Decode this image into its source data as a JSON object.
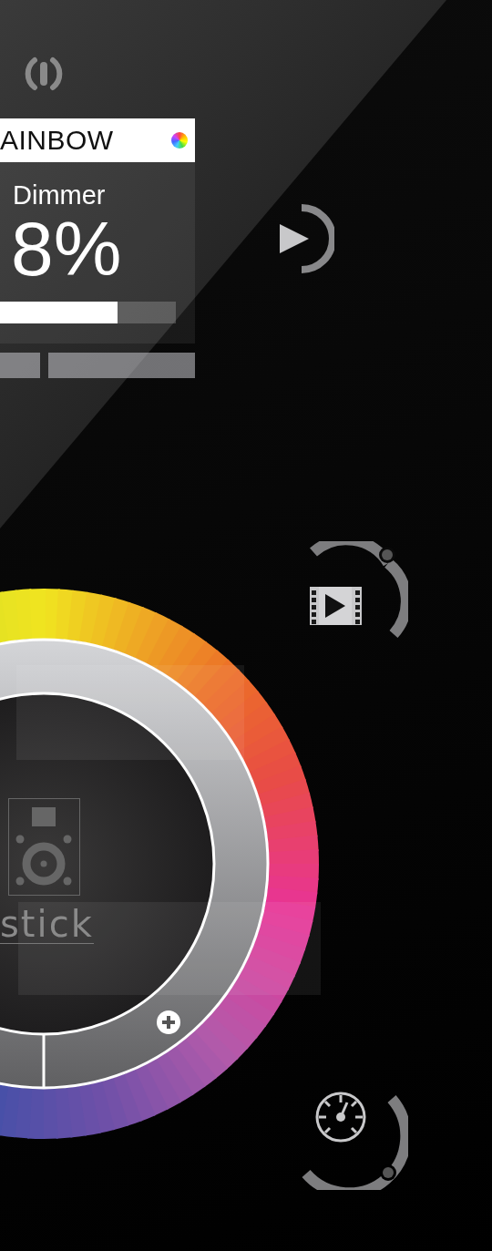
{
  "preset": {
    "name": "AINBOW",
    "parameter": "Dimmer",
    "value": "8%",
    "level": 0.67
  },
  "logo": {
    "text": "stick"
  }
}
